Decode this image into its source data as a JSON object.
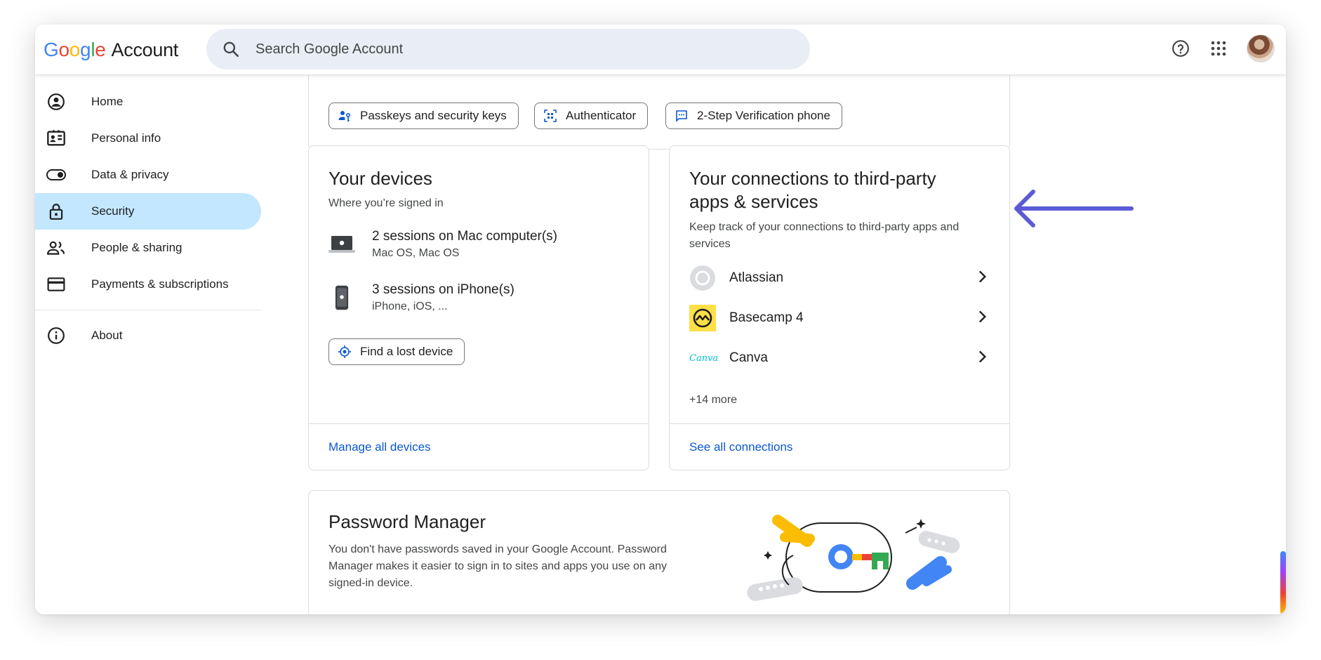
{
  "header": {
    "logo_google": [
      "G",
      "o",
      "o",
      "g",
      "l",
      "e"
    ],
    "logo_account": "Account",
    "search_placeholder": "Search Google Account",
    "icons": [
      "help-icon",
      "apps-grid-icon",
      "avatar"
    ]
  },
  "sidebar": {
    "items": [
      {
        "label": "Home",
        "icon": "home-icon",
        "active": false
      },
      {
        "label": "Personal info",
        "icon": "id-card-icon",
        "active": false
      },
      {
        "label": "Data & privacy",
        "icon": "toggle-icon",
        "active": false
      },
      {
        "label": "Security",
        "icon": "lock-icon",
        "active": true
      },
      {
        "label": "People & sharing",
        "icon": "people-icon",
        "active": false
      },
      {
        "label": "Payments & subscriptions",
        "icon": "credit-card-icon",
        "active": false
      }
    ],
    "footer_items": [
      {
        "label": "About",
        "icon": "info-icon"
      }
    ]
  },
  "signin_chips": [
    {
      "label": "Passkeys and security keys",
      "icon": "passkey-icon"
    },
    {
      "label": "Authenticator",
      "icon": "qr-icon"
    },
    {
      "label": "2-Step Verification phone",
      "icon": "message-icon"
    }
  ],
  "devices": {
    "title": "Your devices",
    "subtitle": "Where you’re signed in",
    "sessions": [
      {
        "title": "2 sessions on Mac computer(s)",
        "detail": "Mac OS, Mac OS",
        "icon": "laptop-icon"
      },
      {
        "title": "3 sessions on iPhone(s)",
        "detail": "iPhone, iOS, ...",
        "icon": "phone-icon"
      }
    ],
    "find_button": "Find a lost device",
    "footer_link": "Manage all devices"
  },
  "connections": {
    "title_line1": "Your connections to third-party",
    "title_line2": "apps & services",
    "subtitle_line1": "Keep track of your connections to third-party apps and",
    "subtitle_line2": "services",
    "apps": [
      {
        "name": "Atlassian",
        "icon": "atlassian-logo"
      },
      {
        "name": "Basecamp 4",
        "icon": "basecamp-logo"
      },
      {
        "name": "Canva",
        "icon": "canva-logo",
        "logo_text": "Canva"
      }
    ],
    "more": "+14 more",
    "footer_link": "See all connections"
  },
  "password_manager": {
    "title": "Password Manager",
    "body_line1": "You don't have passwords saved in your Google Account. Password",
    "body_line2": "Manager makes it easier to sign in to sites and apps you use on any",
    "body_line3": "signed-in device."
  },
  "colors": {
    "accent_link": "#0b57d0",
    "active_nav": "#c2e7ff",
    "annotation_arrow": "#5b5bd6"
  }
}
